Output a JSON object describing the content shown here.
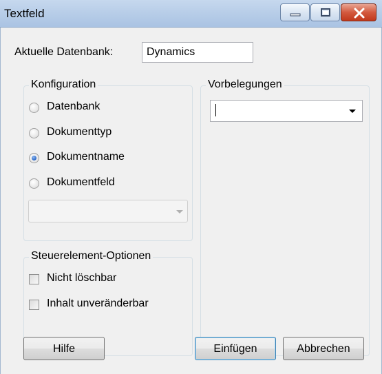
{
  "window": {
    "title": "Textfeld"
  },
  "database": {
    "label": "Aktuelle Datenbank:",
    "value": "Dynamics"
  },
  "konfiguration": {
    "title": "Konfiguration",
    "options": [
      {
        "label": "Datenbank",
        "checked": false
      },
      {
        "label": "Dokumenttyp",
        "checked": false
      },
      {
        "label": "Dokumentname",
        "checked": true
      },
      {
        "label": "Dokumentfeld",
        "checked": false
      }
    ],
    "field_combo_value": ""
  },
  "vorbelegungen": {
    "title": "Vorbelegungen",
    "value": ""
  },
  "options": {
    "title": "Steuerelement-Optionen",
    "items": [
      {
        "label": "Nicht löschbar",
        "checked": false
      },
      {
        "label": "Inhalt unveränderbar",
        "checked": false
      }
    ]
  },
  "buttons": {
    "help": "Hilfe",
    "insert": "Einfügen",
    "cancel": "Abbrechen"
  },
  "colors": {
    "accent_radio": "#2764c7",
    "close_button": "#c1381c",
    "titlebar": "#b7cde8"
  }
}
